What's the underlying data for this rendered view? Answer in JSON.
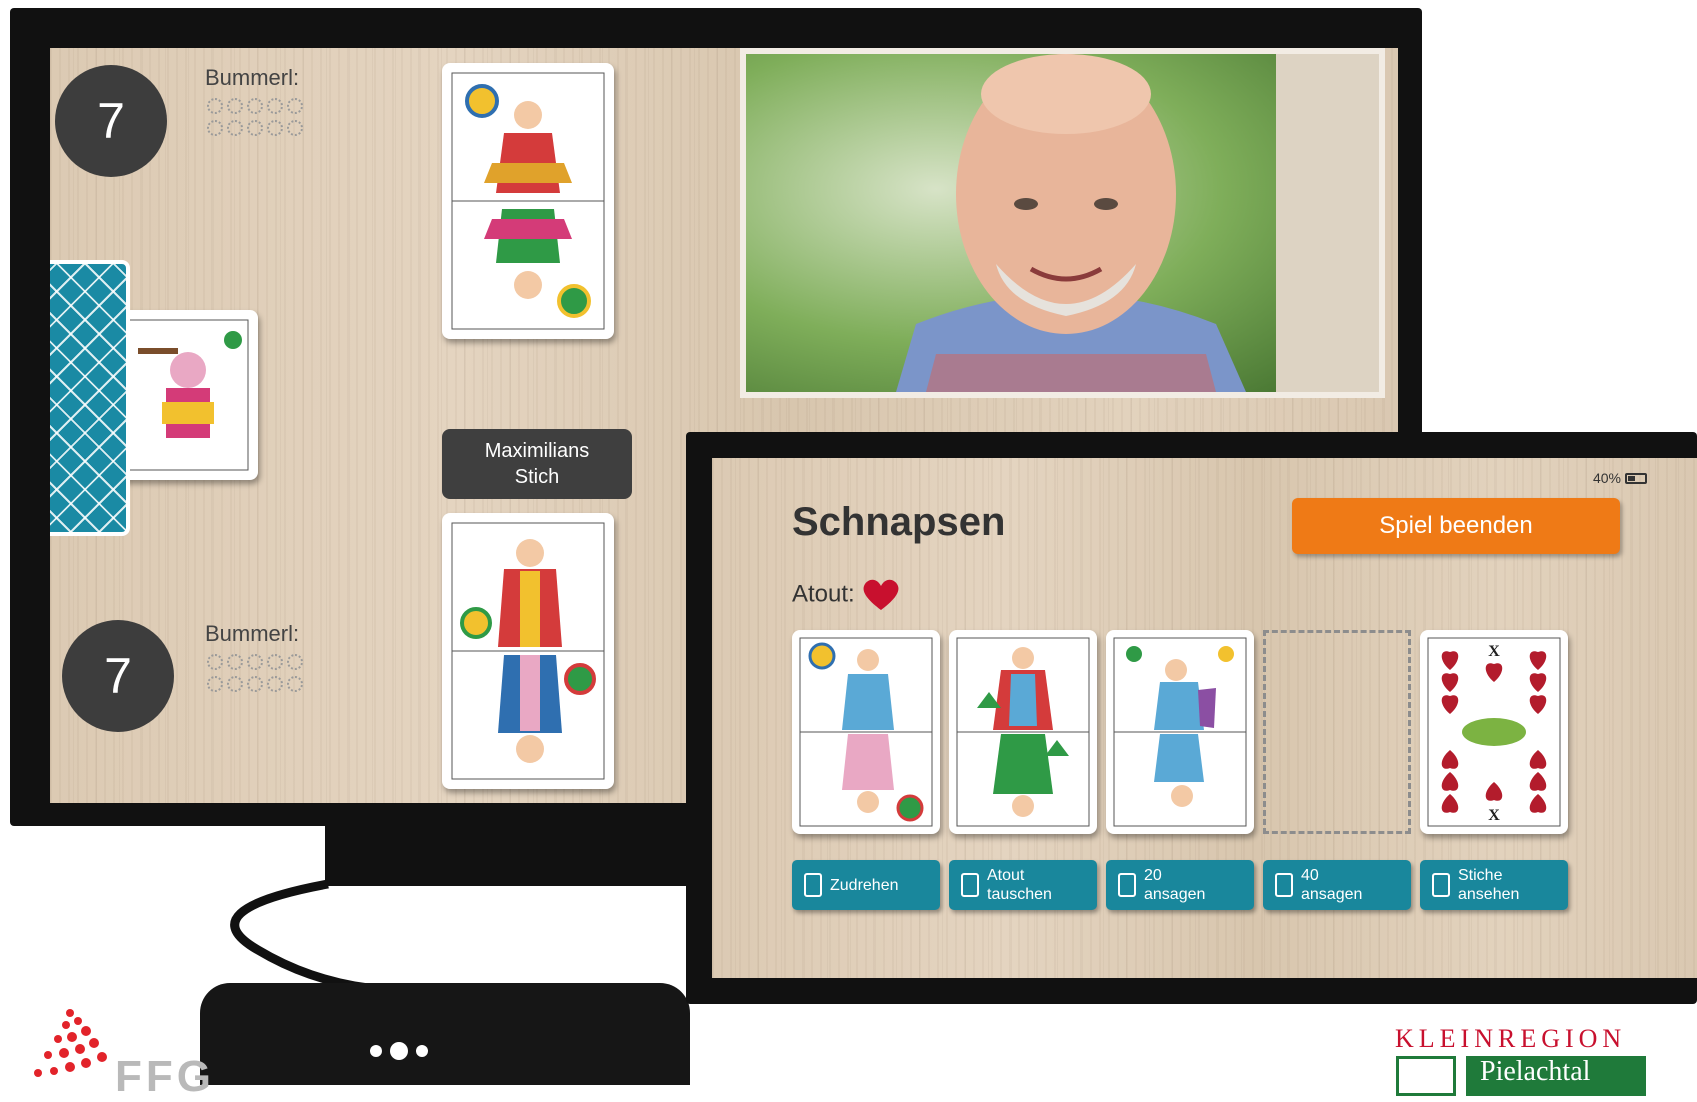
{
  "tv": {
    "top_player": {
      "score": "7",
      "bummerl_label": "Bummerl:"
    },
    "bottom_player": {
      "score": "7",
      "bummerl_label": "Bummerl:"
    },
    "trick_banner": {
      "line1": "Maximilians",
      "line2": "Stich"
    }
  },
  "tablet": {
    "battery": "40%",
    "title": "Schnapsen",
    "end_button": "Spiel beenden",
    "atout_label": "Atout:",
    "atout_suit": "heart-icon",
    "actions": [
      {
        "line1": "Zudrehen",
        "line2": ""
      },
      {
        "line1": "Atout",
        "line2": "tauschen"
      },
      {
        "line1": "20",
        "line2": "ansagen"
      },
      {
        "line1": "40",
        "line2": "ansagen"
      },
      {
        "line1": "Stiche",
        "line2": "ansehen"
      }
    ]
  },
  "logos": {
    "left": "FFG",
    "region_top": "KLEINREGION",
    "region_name": "Pielachtal"
  },
  "colors": {
    "end_button": "#ef7a16",
    "action_button": "#19879c",
    "score_circle": "#3d3d3d",
    "card_back": "#1a8aa4"
  }
}
